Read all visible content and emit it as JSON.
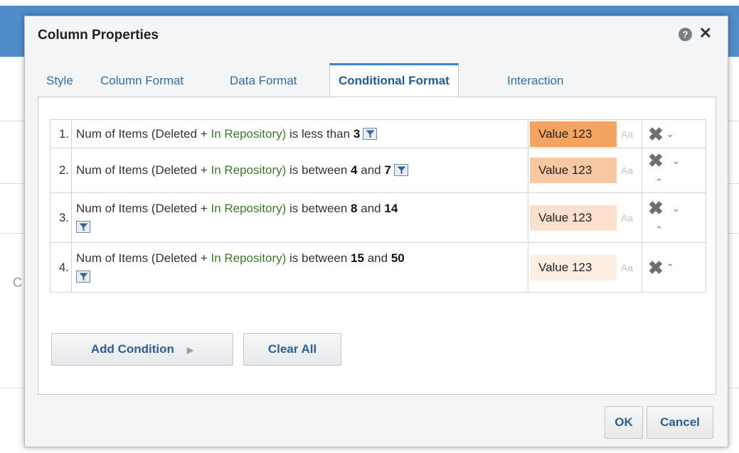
{
  "dialog": {
    "title": "Column Properties",
    "help_icon": "question-circle-icon",
    "close_icon": "close-icon",
    "help_symbol": "?",
    "close_symbol": "✕"
  },
  "tabs": [
    {
      "label": "Style",
      "active": false
    },
    {
      "label": "Column Format",
      "active": false
    },
    {
      "label": "Data Format",
      "active": false
    },
    {
      "label": "Conditional Format",
      "active": true
    },
    {
      "label": "Interaction",
      "active": false
    }
  ],
  "conditions": [
    {
      "index": "1.",
      "prefix": "Num of Items (Deleted",
      "plus": "+",
      "in_text": "In Repository)",
      "operator": "is less than",
      "value1": "3",
      "and": "",
      "value2": "",
      "format_label": "Value 123",
      "aa": "Aa",
      "swatch_color": "#f4a460"
    },
    {
      "index": "2.",
      "prefix": "Num of Items (Deleted",
      "plus": "+",
      "in_text": "In Repository)",
      "operator": "is between",
      "value1": "4",
      "and": "and",
      "value2": "7",
      "format_label": "Value 123",
      "aa": "Aa",
      "swatch_color": "#f8c8a2"
    },
    {
      "index": "3.",
      "prefix": "Num of Items (Deleted",
      "plus": "+",
      "in_text": "In Repository)",
      "operator": "is between",
      "value1": "8",
      "and": "and",
      "value2": "14",
      "format_label": "Value 123",
      "aa": "Aa",
      "swatch_color": "#fbe1cd"
    },
    {
      "index": "4.",
      "prefix": "Num of Items (Deleted",
      "plus": "+",
      "in_text": "In Repository)",
      "operator": "is between",
      "value1": "15",
      "and": "and",
      "value2": "50",
      "format_label": "Value 123",
      "aa": "Aa",
      "swatch_color": "#fdeee3"
    }
  ],
  "buttons": {
    "add_condition": "Add Condition",
    "add_arrow": "▶",
    "clear_all": "Clear All",
    "ok": "OK",
    "cancel": "Cancel"
  },
  "icons": {
    "filter": "filter-icon",
    "delete": "delete-x-icon",
    "move_down": "chevron-down-icon",
    "move_up": "chevron-up-icon",
    "delete_symbol": "✖",
    "down_symbol": "⌄",
    "up_symbol": "⌃"
  },
  "background": {
    "letter": "C"
  }
}
